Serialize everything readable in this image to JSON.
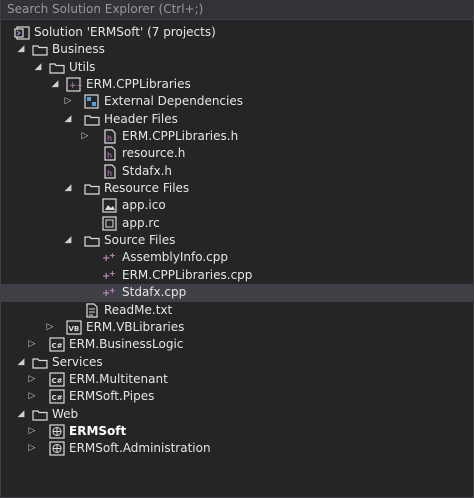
{
  "search": {
    "placeholder": "Search Solution Explorer (Ctrl+;)"
  },
  "tree": {
    "solution": "Solution 'ERMSoft' (7 projects)",
    "business": "Business",
    "utils": "Utils",
    "cpp_project": "ERM.CPPLibraries",
    "external_deps": "External Dependencies",
    "header_files": "Header Files",
    "header_cpplibs": "ERM.CPPLibraries.h",
    "header_resource": "resource.h",
    "header_stdafx": "Stdafx.h",
    "resource_files": "Resource Files",
    "res_appico": "app.ico",
    "res_apprc": "app.rc",
    "source_files": "Source Files",
    "src_assemblyinfo": "AssemblyInfo.cpp",
    "src_cpplibs": "ERM.CPPLibraries.cpp",
    "src_stdafx": "Stdafx.cpp",
    "readme": "ReadMe.txt",
    "vb_project": "ERM.VBLibraries",
    "businesslogic": "ERM.BusinessLogic",
    "services": "Services",
    "multitenant": "ERM.Multitenant",
    "pipes": "ERMSoft.Pipes",
    "web": "Web",
    "ermsoft": "ERMSoft",
    "administration": "ERMSoft.Administration"
  },
  "icons": {
    "vb_badge": "VB",
    "cs_badge": "C#"
  },
  "colors": {
    "background": "#252526",
    "selection": "#3f3f46",
    "folder": "#dcdcdc",
    "cpp_plus": "#c586c0"
  }
}
